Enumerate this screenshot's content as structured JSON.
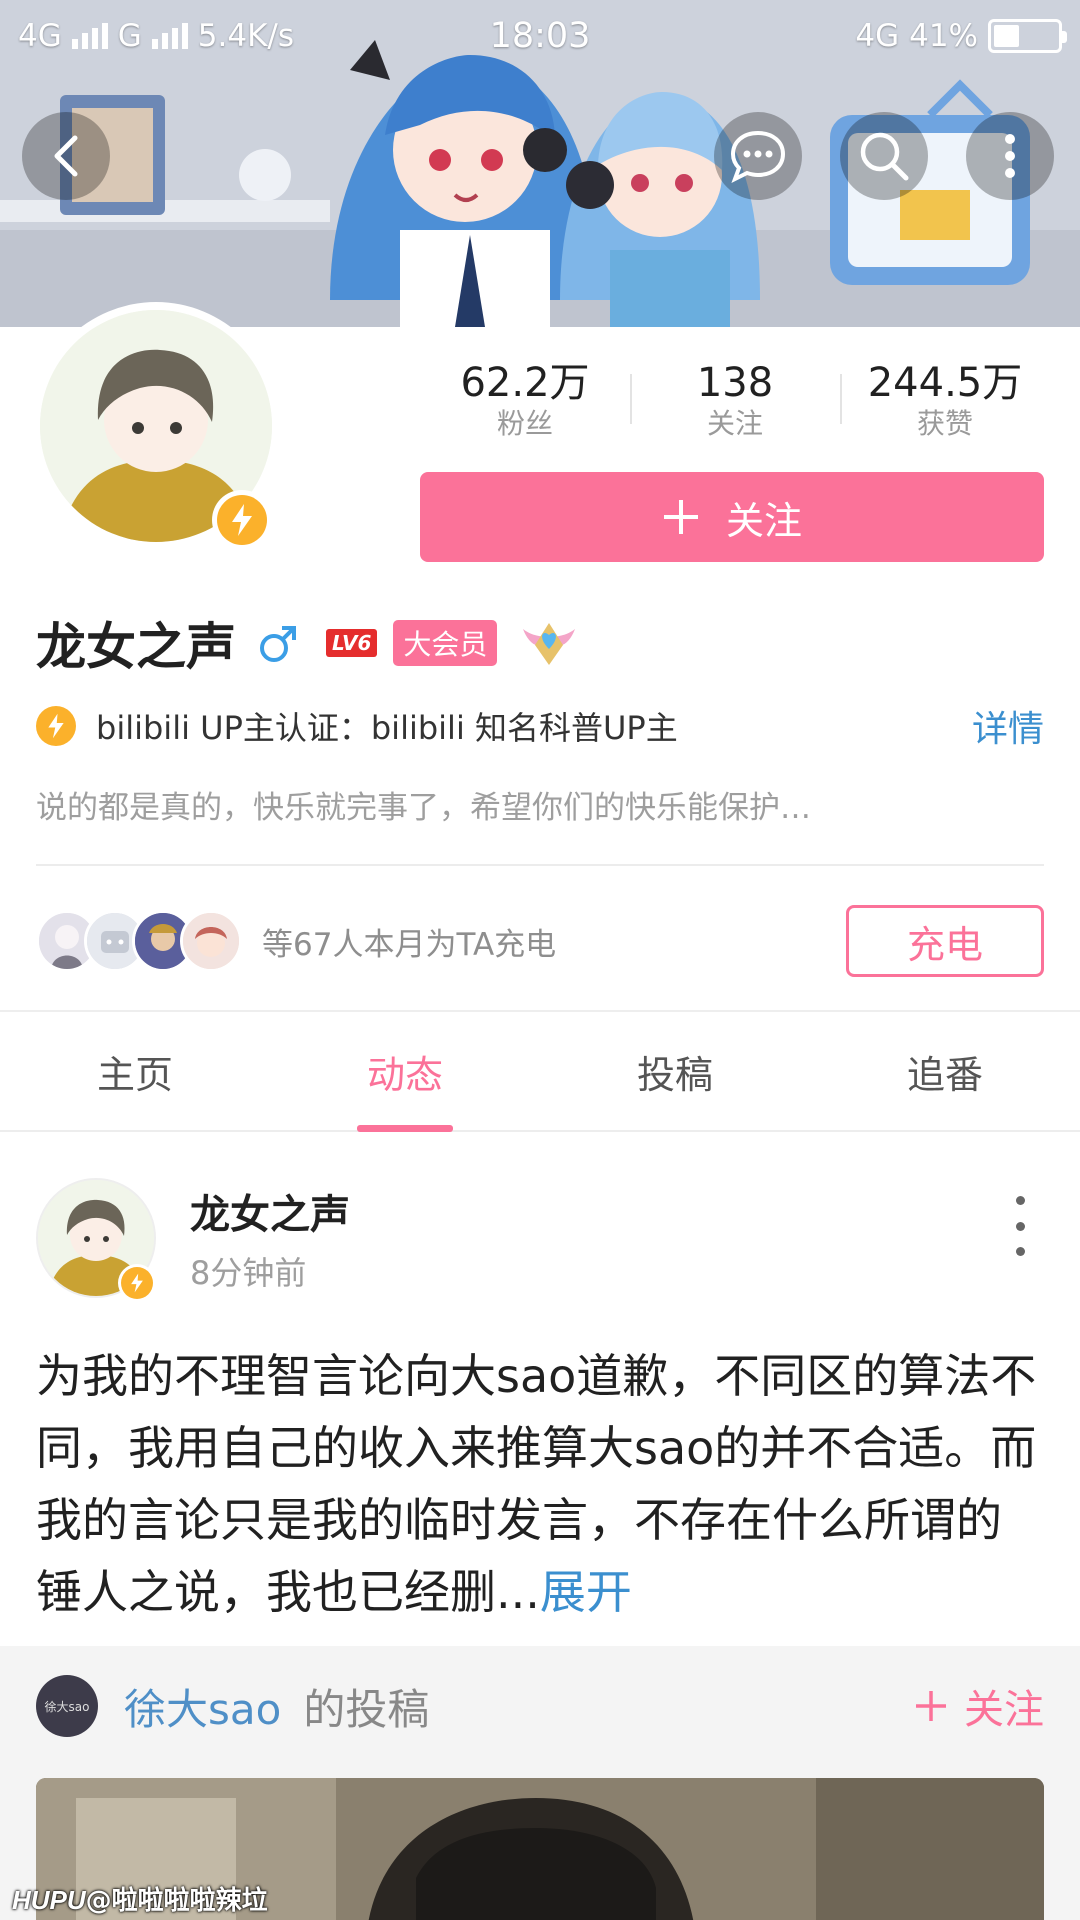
{
  "status_bar": {
    "network_left": "4G",
    "network_mid": "G",
    "speed": "5.4K/s",
    "time": "18:03",
    "network_right": "4G",
    "battery": "41%",
    "battery_level": 0.41
  },
  "profile": {
    "stats": [
      {
        "value": "62.2万",
        "label": "粉丝"
      },
      {
        "value": "138",
        "label": "关注"
      },
      {
        "value": "244.5万",
        "label": "获赞"
      }
    ],
    "follow_button": "关注",
    "name": "龙女之声",
    "level": "LV6",
    "vip_label": "大会员",
    "verification": "bilibili UP主认证：bilibili 知名科普UP主",
    "detail_link": "详情",
    "signature": "说的都是真的，快乐就完事了，希望你们的快乐能保护…",
    "charge_text": "等67人本月为TA充电",
    "charge_button": "充电"
  },
  "tabs": [
    {
      "label": "主页",
      "active": false
    },
    {
      "label": "动态",
      "active": true
    },
    {
      "label": "投稿",
      "active": false
    },
    {
      "label": "追番",
      "active": false
    }
  ],
  "post": {
    "author": "龙女之声",
    "time": "8分钟前",
    "text": "为我的不理智言论向大sao道歉，不同区的算法不同，我用自己的收入来推算大sao的并不合适。而我的言论只是我的临时发言，不存在什么所谓的锤人之说，我也已经删...",
    "expand_link": "展开"
  },
  "repost": {
    "avatar_text": "徐大sao",
    "user": "徐大sao",
    "suffix": "的投稿",
    "follow_label": "关注"
  },
  "watermark": {
    "brand": "HUPU",
    "handle": "@啦啦啦啦辣垃"
  },
  "colors": {
    "accent_pink": "#fb7299",
    "link_blue": "#3b8fcf",
    "bolt_yellow": "#fbb12b"
  }
}
